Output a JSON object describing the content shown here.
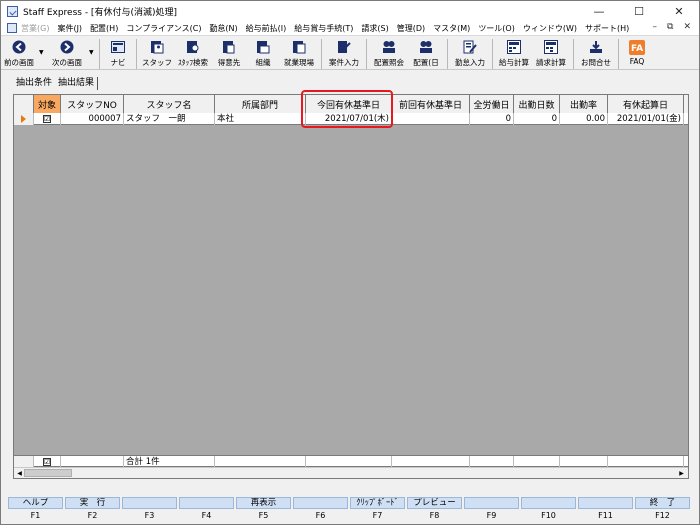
{
  "window": {
    "title": "Staff Express - [有休付与(消滅)処理]"
  },
  "menu": [
    {
      "label": "営業(G)",
      "enabled": false
    },
    {
      "label": "案件(J)",
      "enabled": true
    },
    {
      "label": "配置(H)",
      "enabled": true
    },
    {
      "label": "コンプライアンス(C)",
      "enabled": true
    },
    {
      "label": "勤怠(N)",
      "enabled": true
    },
    {
      "label": "給与前払(I)",
      "enabled": true
    },
    {
      "label": "給与賞与手続(T)",
      "enabled": true
    },
    {
      "label": "請求(S)",
      "enabled": true
    },
    {
      "label": "管理(D)",
      "enabled": true
    },
    {
      "label": "マスタ(M)",
      "enabled": true
    },
    {
      "label": "ツール(O)",
      "enabled": true
    },
    {
      "label": "ウィンドウ(W)",
      "enabled": true
    },
    {
      "label": "サポート(H)",
      "enabled": true
    }
  ],
  "toolbar": [
    {
      "label": "前の画面",
      "icon": "back-arrow-icon"
    },
    {
      "label": "次の画面",
      "icon": "forward-arrow-icon"
    },
    {
      "label": "ナビ",
      "icon": "navi-icon"
    },
    {
      "label": "スタッフ",
      "icon": "staff-icon"
    },
    {
      "label": "ｽﾀｯﾌ検索",
      "icon": "staff-search-icon"
    },
    {
      "label": "得意先",
      "icon": "client-icon"
    },
    {
      "label": "組織",
      "icon": "organization-icon"
    },
    {
      "label": "就業現場",
      "icon": "worksite-icon"
    },
    {
      "label": "案件入力",
      "icon": "job-entry-icon"
    },
    {
      "label": "配置照会",
      "icon": "placement-query-icon"
    },
    {
      "label": "配置(日",
      "icon": "placement-daily-icon"
    },
    {
      "label": "勤怠入力",
      "icon": "attendance-entry-icon"
    },
    {
      "label": "給与計算",
      "icon": "payroll-calc-icon"
    },
    {
      "label": "請求計算",
      "icon": "billing-calc-icon"
    },
    {
      "label": "お問合せ",
      "icon": "inquiry-icon"
    },
    {
      "label": "FAQ",
      "icon": "faq-icon"
    }
  ],
  "tabs": [
    {
      "label": "抽出条件",
      "selected": false
    },
    {
      "label": "抽出結果",
      "selected": true
    }
  ],
  "grid": {
    "columns": [
      "対象",
      "スタッフNO",
      "スタッフ名",
      "所属部門",
      "今回有休基準日",
      "前回有休基準日",
      "全労働日",
      "出勤日数",
      "出勤率",
      "有休起算日"
    ],
    "rows": [
      {
        "target": "☑",
        "staff_no": "000007",
        "staff_name": "スタッフ　一朗",
        "department": "本社",
        "current_base_date": "2021/07/01(木)",
        "previous_base_date": "",
        "total_work_days": "0",
        "attendance_days": "0",
        "attendance_rate": "0.00",
        "paid_leave_start": "2021/01/01(金)"
      }
    ],
    "footer": {
      "total_label": "合計 1件"
    }
  },
  "fkeys": [
    {
      "label": "ヘルプ",
      "key": "F1"
    },
    {
      "label": "実　行",
      "key": "F2"
    },
    {
      "label": "",
      "key": "F3"
    },
    {
      "label": "",
      "key": "F4"
    },
    {
      "label": "再表示",
      "key": "F5"
    },
    {
      "label": "",
      "key": "F6"
    },
    {
      "label": "ｸﾘｯﾌﾟﾎﾞｰﾄﾞ",
      "key": "F7"
    },
    {
      "label": "プレビュー",
      "key": "F8"
    },
    {
      "label": "",
      "key": "F9"
    },
    {
      "label": "",
      "key": "F10"
    },
    {
      "label": "",
      "key": "F11"
    },
    {
      "label": "終　了",
      "key": "F12"
    }
  ],
  "colors": {
    "highlight": "#e8191e",
    "target_header": "#f8a860",
    "fkey_bg": "#cfe0f4"
  }
}
